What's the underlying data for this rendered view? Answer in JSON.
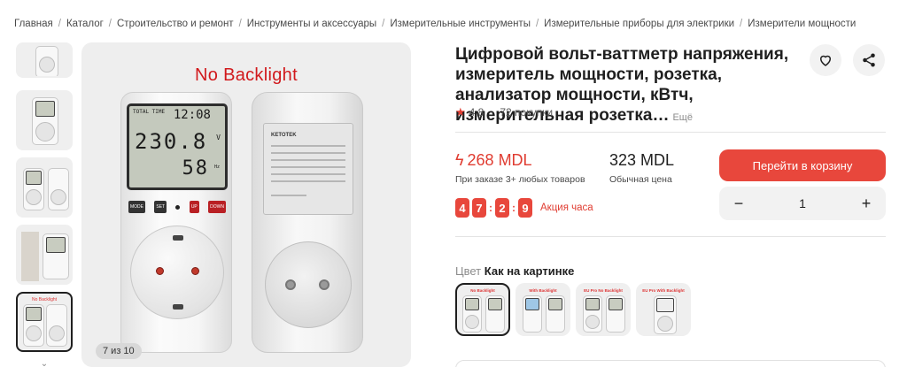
{
  "breadcrumb": [
    "Главная",
    "Каталог",
    "Строительство и ремонт",
    "Инструменты и аксессуары",
    "Измерительные инструменты",
    "Измерительные приборы для электрики",
    "Измерители мощности"
  ],
  "gallery": {
    "overlay_text": "No Backlight",
    "counter": "7 из 10",
    "device": {
      "lcd_small": "TOTAL TIME",
      "lcd_time": "12:08",
      "lcd_voltage": "230.8",
      "lcd_voltage_unit": "V",
      "lcd_hz": "58",
      "lcd_hz_unit": "Hz",
      "buttons": [
        "MODE",
        "SET",
        "UP",
        "DOWN"
      ],
      "brand": "KETOTEK"
    }
  },
  "product": {
    "title": "Цифровой вольт-ваттметр напряжения, измеритель мощности, розетка, анализатор мощности, кВтч, измерительная розетка…",
    "more_link": "Ещё",
    "rating": "4,8",
    "purchases": "72 покупки"
  },
  "pricing": {
    "promo_price": "268 MDL",
    "promo_note": "При заказе 3+ любых товаров",
    "regular_price": "323 MDL",
    "regular_note": "Обычная цена",
    "timer_digits": [
      "4",
      "7",
      "2",
      "9"
    ],
    "timer_label": "Акция часа"
  },
  "actions": {
    "cart_label": "Перейти в корзину",
    "quantity": "1",
    "minus": "−",
    "plus": "+"
  },
  "color": {
    "label": "Цвет",
    "value": "Как на картинке",
    "variant_texts": [
      "No Backlight",
      "With Backlight",
      "EU Pro No Backlight",
      "EU Pro With Backlight"
    ]
  },
  "colors": {
    "accent": "#e8473c",
    "price_red": "#e03c31"
  }
}
